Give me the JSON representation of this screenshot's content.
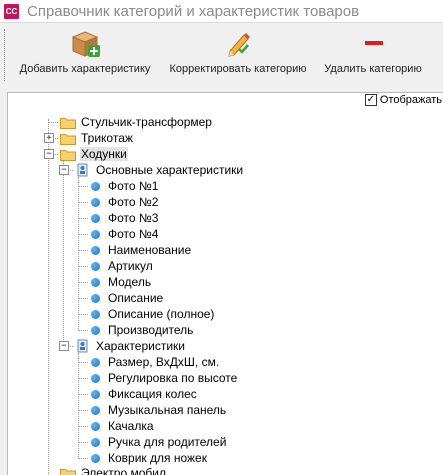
{
  "window": {
    "title": "Справочник категорий и характеристик товаров",
    "app_icon": "СС"
  },
  "toolbar": {
    "add_label": "Добавить характеристику",
    "edit_label": "Корректировать категорию",
    "delete_label": "Удалить категорию"
  },
  "panel": {
    "show_label": "Отображать",
    "show_checked": true
  },
  "tree": {
    "categories": [
      {
        "label": "Стульчик-трансформер"
      },
      {
        "label": "Трикотаж"
      },
      {
        "label": "Ходунки"
      },
      {
        "label": "Электро мобил"
      }
    ],
    "groups": [
      {
        "label": "Основные характеристики"
      },
      {
        "label": "Характеристики"
      }
    ],
    "main_features": [
      {
        "label": "Фото №1"
      },
      {
        "label": "Фото №2"
      },
      {
        "label": "Фото №3"
      },
      {
        "label": "Фото №4"
      },
      {
        "label": "Наименование"
      },
      {
        "label": "Артикул"
      },
      {
        "label": "Модель"
      },
      {
        "label": "Описание"
      },
      {
        "label": "Описание (полное)"
      },
      {
        "label": "Производитель"
      }
    ],
    "other_features": [
      {
        "label": "Размер, ВхДхШ, см."
      },
      {
        "label": "Регулировка по высоте"
      },
      {
        "label": "Фиксация колес"
      },
      {
        "label": "Музыкальная панель"
      },
      {
        "label": "Качалка"
      },
      {
        "label": "Ручка для родителей"
      },
      {
        "label": "Коврик для ножек"
      }
    ]
  }
}
